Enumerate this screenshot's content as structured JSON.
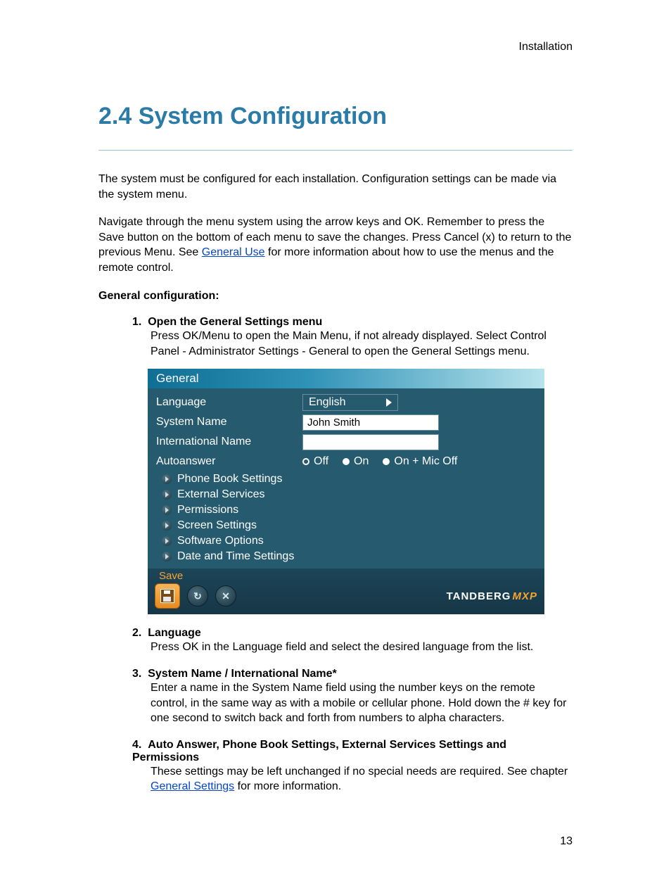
{
  "header_label": "Installation",
  "title": "2.4 System Configuration",
  "intro1": "The system must be configured for each installation. Configuration settings can be made via the system menu.",
  "intro2a": "Navigate through the menu system using the arrow keys and OK. Remember to press the Save button on the bottom of each menu to save the changes. Press Cancel (x) to return to the previous Menu. See ",
  "intro2_link": "General Use",
  "intro2b": " for more information about how to use the menus and the remote control.",
  "section_label": "General configuration:",
  "steps": {
    "s1_num": "1.",
    "s1_title": "Open the General Settings menu",
    "s1_body": "Press OK/Menu to open the Main Menu, if not already displayed. Select Control Panel - Administrator Settings - General to open the General Settings menu.",
    "s2_num": "2.",
    "s2_title": "Language",
    "s2_body": "Press OK in the Language field and select the desired language from the list.",
    "s3_num": "3.",
    "s3_title": "System Name / International Name*",
    "s3_body": "Enter a name in the System Name field using the number keys on the remote control, in the same way as with a mobile or cellular phone. Hold down the # key for one second to switch back and forth from numbers to alpha characters.",
    "s4_num": "4.",
    "s4_title": "Auto Answer, Phone Book Settings, External Services Settings and Permissions",
    "s4_body_a": "These settings may be left unchanged if no special needs are required. See chapter ",
    "s4_link": "General Settings",
    "s4_body_b": " for more information."
  },
  "panel": {
    "title": "General",
    "rows": {
      "language_label": "Language",
      "language_value": "English",
      "sysname_label": "System Name",
      "sysname_value": "John Smith",
      "intlname_label": "International Name",
      "intlname_value": "",
      "autoanswer_label": "Autoanswer",
      "autoanswer_options": {
        "off": "Off",
        "on": "On",
        "onmicoff": "On + Mic Off"
      }
    },
    "subitems": [
      "Phone Book Settings",
      "External Services",
      "Permissions",
      "Screen Settings",
      "Software Options",
      "Date and Time Settings"
    ],
    "save_label": "Save",
    "brand": "TANDBERG",
    "brand_suffix": "MXP"
  },
  "page_number": "13"
}
